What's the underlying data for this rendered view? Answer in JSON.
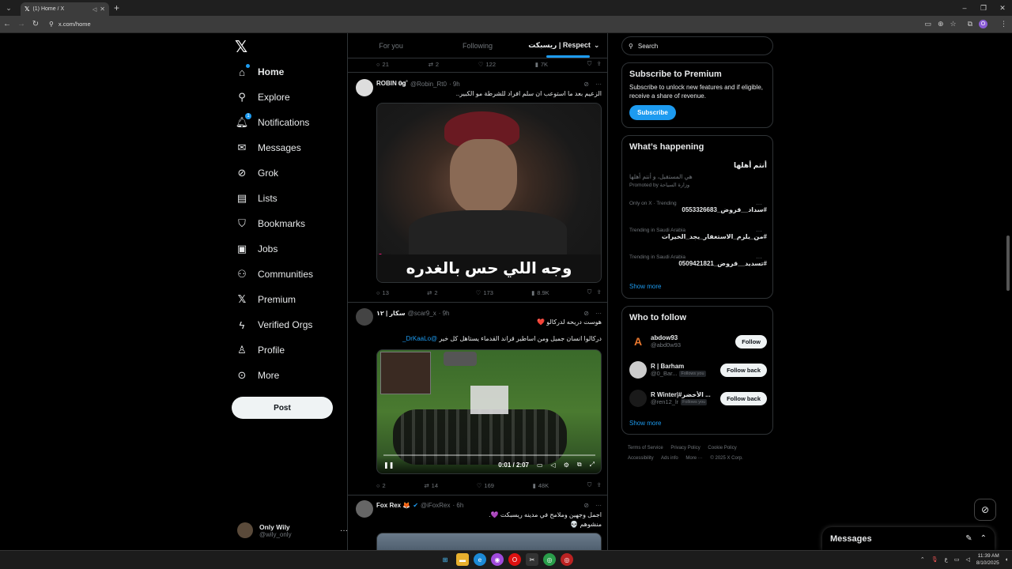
{
  "browser": {
    "tab_title": "(1) Home / X",
    "url": "x.com/home",
    "profile_initial": "O"
  },
  "nav": {
    "items": [
      {
        "label": "Home",
        "icon": "home-icon"
      },
      {
        "label": "Explore",
        "icon": "search-icon"
      },
      {
        "label": "Notifications",
        "icon": "bell-icon",
        "badge": "1"
      },
      {
        "label": "Messages",
        "icon": "mail-icon"
      },
      {
        "label": "Grok",
        "icon": "grok-icon"
      },
      {
        "label": "Lists",
        "icon": "list-icon"
      },
      {
        "label": "Bookmarks",
        "icon": "bookmark-icon"
      },
      {
        "label": "Jobs",
        "icon": "briefcase-icon"
      },
      {
        "label": "Communities",
        "icon": "people-icon"
      },
      {
        "label": "Premium",
        "icon": "x-icon"
      },
      {
        "label": "Verified Orgs",
        "icon": "lightning-icon"
      },
      {
        "label": "Profile",
        "icon": "person-icon"
      },
      {
        "label": "More",
        "icon": "more-circle-icon"
      }
    ],
    "post_label": "Post",
    "account": {
      "name": "Only Wily",
      "handle": "@wily_only"
    }
  },
  "timeline": {
    "tabs": [
      "For you",
      "Following",
      "ريسبكت | Respect"
    ],
    "prev_actions": {
      "replies": "21",
      "reposts": "2",
      "likes": "122",
      "views": "7K"
    },
    "tweets": [
      {
        "name": "ROBIN 𝟎𝐠˚",
        "handle": "@Robin_Rt0",
        "time": "9h",
        "text": "الزعيم بعد ما استوعب ان سلم افراد للشرطة مو الكبير..",
        "caption": "وجه اللي حس بالغدره",
        "actions": {
          "replies": "13",
          "reposts": "2",
          "likes": "173",
          "views": "8.9K"
        }
      },
      {
        "name": "سكار | ١٢",
        "handle": "@scar9_x",
        "time": "9h",
        "text": "هوست دريحه لدركالو ❤️",
        "text2": "دركالوا انسان جميل ومن اساطير قراند القدماء يستاهل كل خير",
        "mention": "@DrKaaLo_",
        "video_time": "0:01 / 2:07",
        "actions": {
          "replies": "2",
          "reposts": "14",
          "likes": "169",
          "views": "48K"
        }
      },
      {
        "name": "Fox Rex 🦊",
        "handle": "@iFoxRex",
        "time": "6h",
        "text": "اجمل وجهين وملامح في مدينه ريسبكت 💜.",
        "text2": "منشوهم 💀"
      }
    ]
  },
  "sidebar": {
    "search_placeholder": "Search",
    "premium": {
      "title": "Subscribe to Premium",
      "desc": "Subscribe to unlock new features and if eligible, receive a share of revenue.",
      "button": "Subscribe"
    },
    "happening": {
      "title": "What’s happening",
      "promo": {
        "title": "أنتم أهلها",
        "subtitle": "هي المستقبل، و أنتم أهلها",
        "promoted": "Promoted by وزارة السياحة"
      },
      "trends": [
        {
          "meta": "Only on X · Trending",
          "title": "#سداد__قروض_0553326683"
        },
        {
          "meta": "Trending in Saudi Arabia",
          "title": "#من_يلزم_الاستغفار_يجد_الخيرات"
        },
        {
          "meta": "Trending in Saudi Arabia",
          "title": "#تسديد__قروض_0509421821"
        }
      ],
      "show_more": "Show more"
    },
    "who_to_follow": {
      "title": "Who to follow",
      "users": [
        {
          "name": "abdow93",
          "handle": "@abd0w93",
          "follows_you": "",
          "button": "Follow"
        },
        {
          "name": "R | Barham",
          "handle": "@0_Bar...",
          "follows_you": "Follows you",
          "button": "Follow back"
        },
        {
          "name": "R Winter|#الأخضر ...",
          "handle": "@ren12_lr",
          "follows_you": "Follows you",
          "button": "Follow back"
        }
      ],
      "show_more": "Show more"
    },
    "footer": [
      "Terms of Service",
      "Privacy Policy",
      "Cookie Policy",
      "Accessibility",
      "Ads info",
      "More ···",
      "© 2025 X Corp."
    ]
  },
  "messages_drawer": {
    "title": "Messages"
  },
  "taskbar": {
    "time": "11:39 AM",
    "date": "8/10/2025",
    "lang": "ع"
  },
  "colors": {
    "accent": "#1d9bf0",
    "background": "#000000",
    "border": "#2f3336",
    "muted": "#71767b"
  }
}
